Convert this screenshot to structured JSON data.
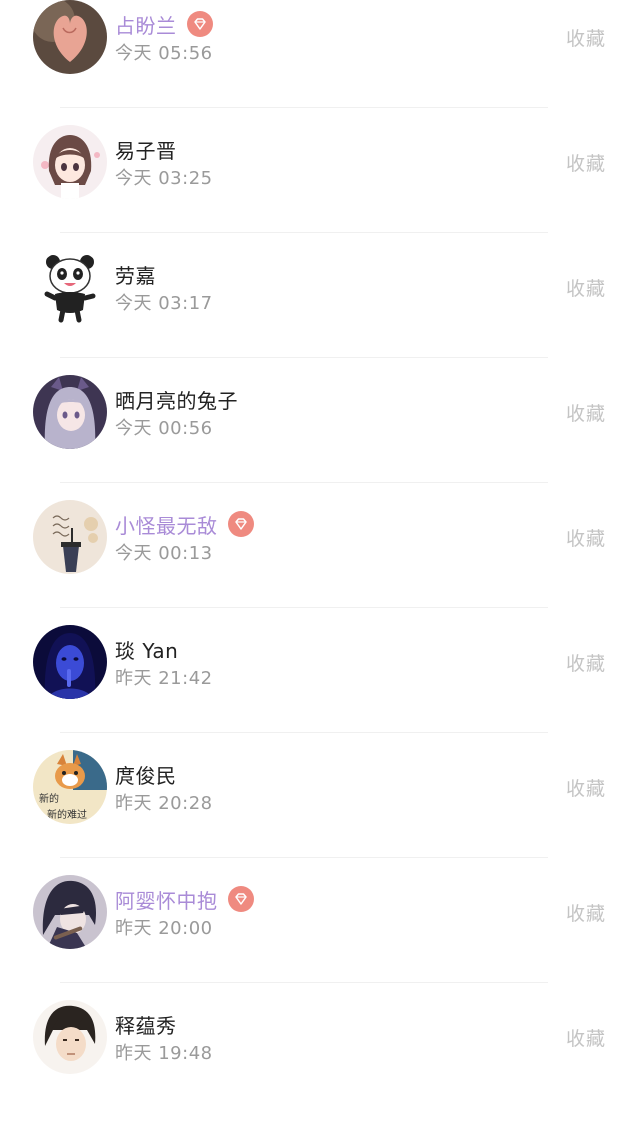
{
  "favorite_label": "收藏",
  "colors": {
    "vip_name": "#a98bd7",
    "vip_badge": "#ef8a80",
    "time": "#9a9a9a",
    "favorite": "#c4c4c4"
  },
  "vip_icon": "diamond-icon",
  "users": [
    {
      "name": "占盼兰",
      "time": "今天 05:56",
      "vip": true,
      "avatar": "hand-heart-avatar"
    },
    {
      "name": "易子晋",
      "time": "今天 03:25",
      "vip": false,
      "avatar": "anime-girl-avatar"
    },
    {
      "name": "劳嘉",
      "time": "今天 03:17",
      "vip": false,
      "avatar": "panda-avatar"
    },
    {
      "name": "晒月亮的兔子",
      "time": "今天 00:56",
      "vip": false,
      "avatar": "anime-girl-cat-ears-avatar"
    },
    {
      "name": "小怪最无敌",
      "time": "今天 00:13",
      "vip": true,
      "avatar": "drink-avatar"
    },
    {
      "name": "琰 Yan",
      "time": "昨天 21:42",
      "vip": false,
      "avatar": "blue-portrait-avatar"
    },
    {
      "name": "庹俊民",
      "time": "昨天 20:28",
      "vip": false,
      "avatar": "cat-meme-avatar",
      "avatar_text": [
        "新的",
        "新的难过"
      ]
    },
    {
      "name": "阿婴怀中抱",
      "time": "昨天 20:00",
      "vip": true,
      "avatar": "anime-boy-avatar"
    },
    {
      "name": "释蕴秀",
      "time": "昨天 19:48",
      "vip": false,
      "avatar": "anime-man-avatar"
    }
  ]
}
